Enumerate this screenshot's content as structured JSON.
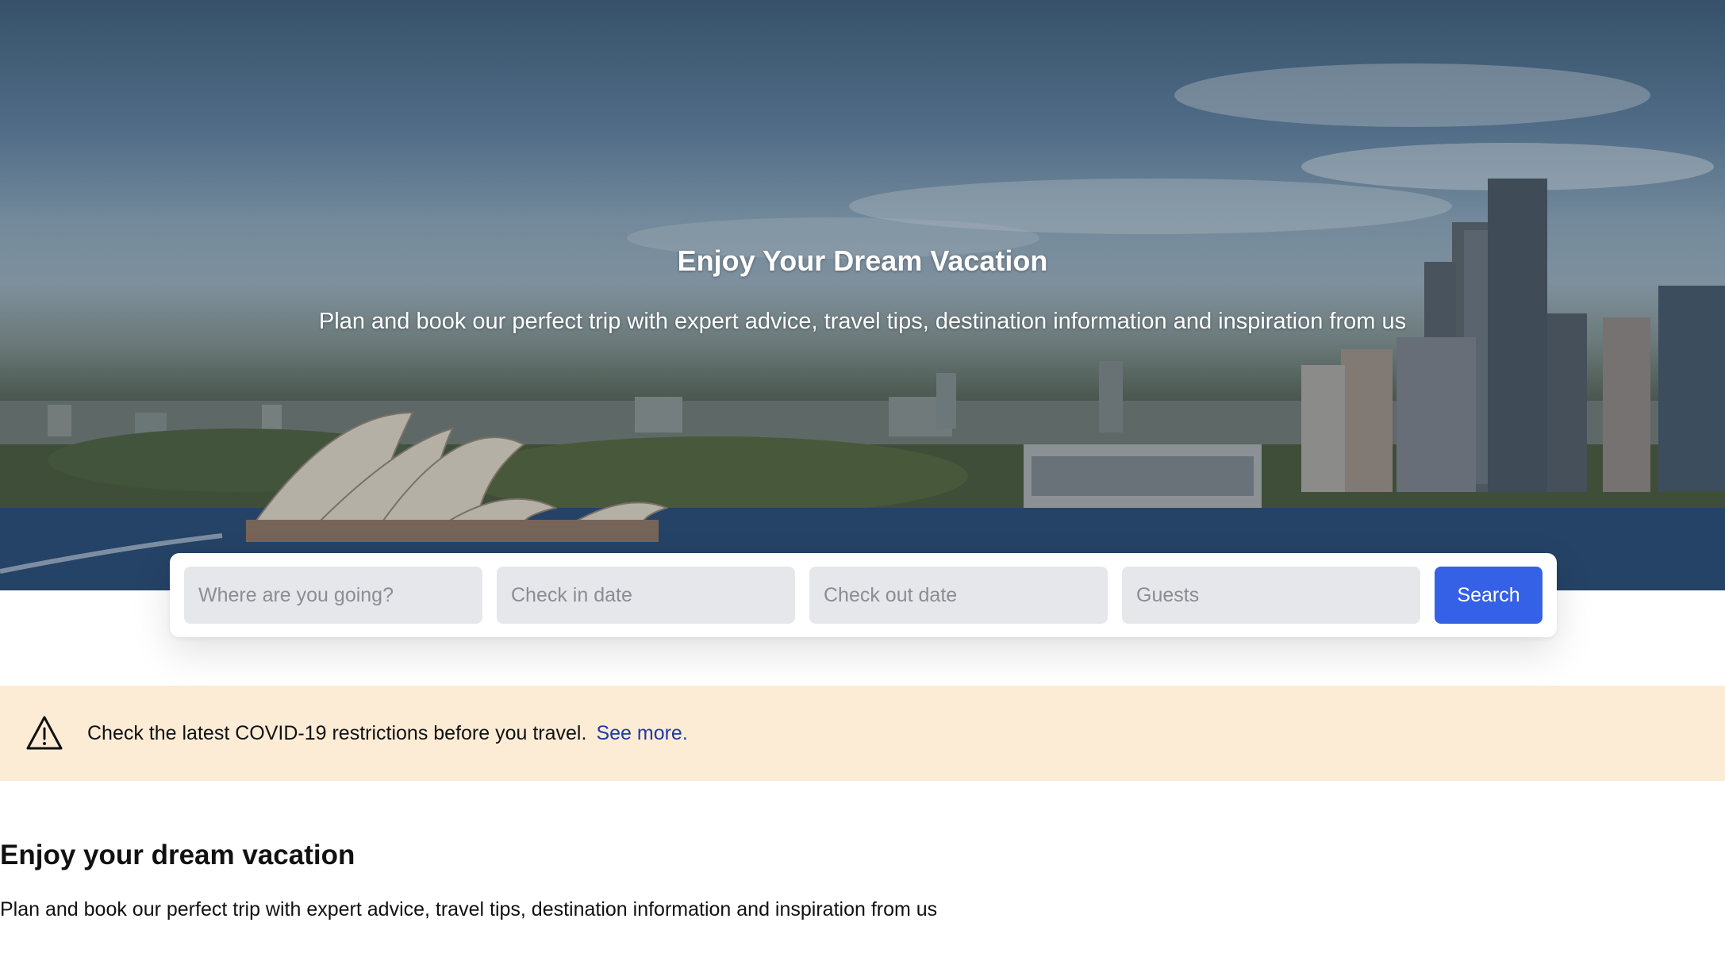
{
  "hero": {
    "title": "Enjoy Your Dream Vacation",
    "subtitle": "Plan and book our perfect trip with expert advice, travel tips, destination information and inspiration from us"
  },
  "search": {
    "destination_placeholder": "Where are you going?",
    "checkin_placeholder": "Check in date",
    "checkout_placeholder": "Check out date",
    "guests_placeholder": "Guests",
    "button_label": "Search"
  },
  "alert": {
    "icon": "warning-triangle-icon",
    "message": "Check the latest COVID-19 restrictions before you travel.",
    "link_label": "See more."
  },
  "content": {
    "title": "Enjoy your dream vacation",
    "body": "Plan and book our perfect trip with expert advice, travel tips, destination information and inspiration from us"
  },
  "colors": {
    "primary_button": "#3461e6",
    "alert_background": "#fcecd6",
    "alert_link": "#1f3aa6",
    "input_background": "#e6e7ea"
  }
}
